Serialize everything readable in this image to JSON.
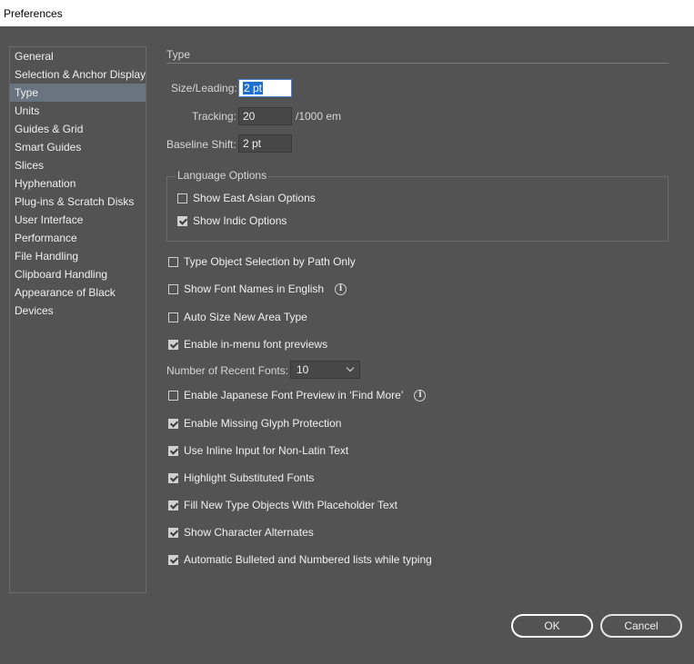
{
  "window": {
    "title": "Preferences"
  },
  "sidebar": {
    "items": [
      {
        "label": "General"
      },
      {
        "label": "Selection & Anchor Display"
      },
      {
        "label": "Type",
        "selected": true
      },
      {
        "label": "Units"
      },
      {
        "label": "Guides & Grid"
      },
      {
        "label": "Smart Guides"
      },
      {
        "label": "Slices"
      },
      {
        "label": "Hyphenation"
      },
      {
        "label": "Plug-ins & Scratch Disks"
      },
      {
        "label": "User Interface"
      },
      {
        "label": "Performance"
      },
      {
        "label": "File Handling"
      },
      {
        "label": "Clipboard Handling"
      },
      {
        "label": "Appearance of Black"
      },
      {
        "label": "Devices"
      }
    ]
  },
  "panel": {
    "section_title": "Type",
    "size_leading": {
      "label": "Size/Leading:",
      "value": "2 pt"
    },
    "tracking": {
      "label": "Tracking:",
      "value": "20",
      "unit": "/1000 em"
    },
    "baseline_shift": {
      "label": "Baseline Shift:",
      "value": "2 pt"
    },
    "language_options": {
      "title": "Language Options",
      "east_asian": {
        "label": "Show East Asian Options",
        "checked": false
      },
      "indic": {
        "label": "Show Indic Options",
        "checked": true
      }
    },
    "options": {
      "type_object_selection": {
        "label": "Type Object Selection by Path Only",
        "checked": false
      },
      "font_names_english": {
        "label": "Show Font Names in English",
        "checked": false,
        "info": "i"
      },
      "auto_size": {
        "label": "Auto Size New Area Type",
        "checked": false
      },
      "inmenu_previews": {
        "label": "Enable in-menu font previews",
        "checked": true
      },
      "japanese_preview": {
        "label": "Enable Japanese Font Preview in ‘Find More’",
        "checked": false,
        "info": "i"
      },
      "missing_glyph": {
        "label": "Enable Missing Glyph Protection",
        "checked": true
      },
      "inline_input": {
        "label": "Use Inline Input for Non-Latin Text",
        "checked": true
      },
      "highlight_substituted": {
        "label": "Highlight Substituted Fonts",
        "checked": true
      },
      "placeholder_text": {
        "label": "Fill New Type Objects With Placeholder Text",
        "checked": true
      },
      "character_alternates": {
        "label": "Show Character Alternates",
        "checked": true
      },
      "bulleted_lists": {
        "label": "Automatic Bulleted and Numbered lists while typing",
        "checked": true
      }
    },
    "recent_fonts": {
      "label": "Number of Recent Fonts:",
      "value": "10"
    }
  },
  "buttons": {
    "ok": "OK",
    "cancel": "Cancel"
  }
}
